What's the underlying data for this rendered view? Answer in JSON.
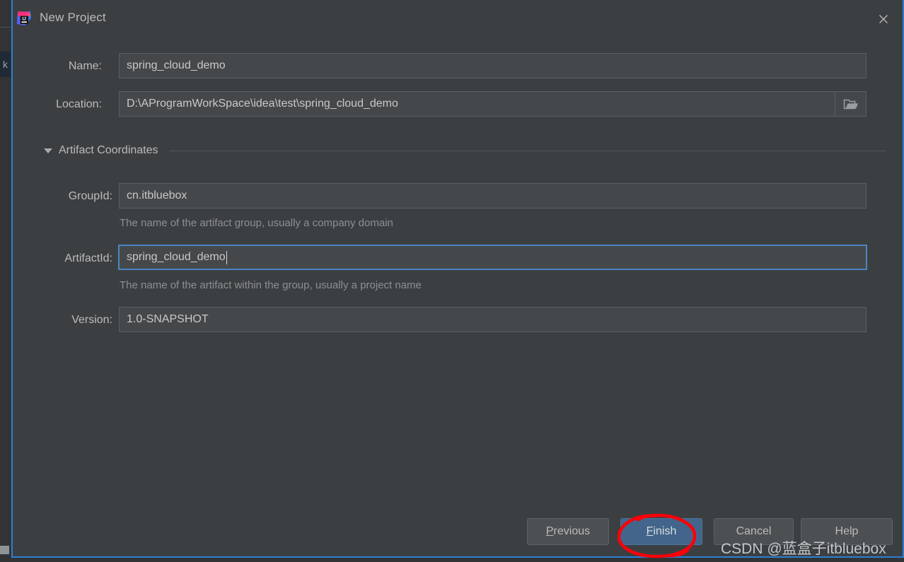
{
  "window": {
    "title": "New Project",
    "logo_icon": "intellij-idea-logo",
    "close_icon": "close-icon"
  },
  "form": {
    "name": {
      "label": "Name:",
      "value": "spring_cloud_demo",
      "placeholder": ""
    },
    "location": {
      "label": "Location:",
      "value": "D:\\AProgramWorkSpace\\idea\\test\\spring_cloud_demo",
      "placeholder": "",
      "browse_icon": "folder-icon"
    },
    "artifact_coordinates": {
      "title": "Artifact Coordinates",
      "expanded": true,
      "toggle_icon": "chevron-down-icon",
      "group_id": {
        "label": "GroupId:",
        "value": "cn.itbluebox",
        "hint": "The name of the artifact group, usually a company domain"
      },
      "artifact_id": {
        "label": "ArtifactId:",
        "value": "spring_cloud_demo",
        "hint": "The name of the artifact within the group, usually a project name",
        "focused": true
      },
      "version": {
        "label": "Version:",
        "value": "1.0-SNAPSHOT"
      }
    }
  },
  "footer": {
    "previous": {
      "label": "Previous",
      "mnemonic": "P"
    },
    "finish": {
      "label": "Finish",
      "mnemonic": "F",
      "primary": true
    },
    "cancel": {
      "label": "Cancel",
      "mnemonic": ""
    },
    "help": {
      "label": "Help",
      "mnemonic": ""
    }
  },
  "annotation": {
    "shape": "red-ellipse-highlight",
    "target": "Finish",
    "color": "#fb0007"
  },
  "watermark": {
    "text": "CSDN @蓝盒子itbluebox"
  },
  "background": {
    "fragment_text": "k"
  },
  "colors": {
    "dialog_bg": "#3c3f41",
    "input_bg": "#45484a",
    "border_accent": "#2b7fd4",
    "focus_border": "#4b84c4",
    "primary_button": "#43658b",
    "text": "#bbbbbb",
    "hint_text": "#8d9092",
    "annotation_red": "#fb0007"
  }
}
